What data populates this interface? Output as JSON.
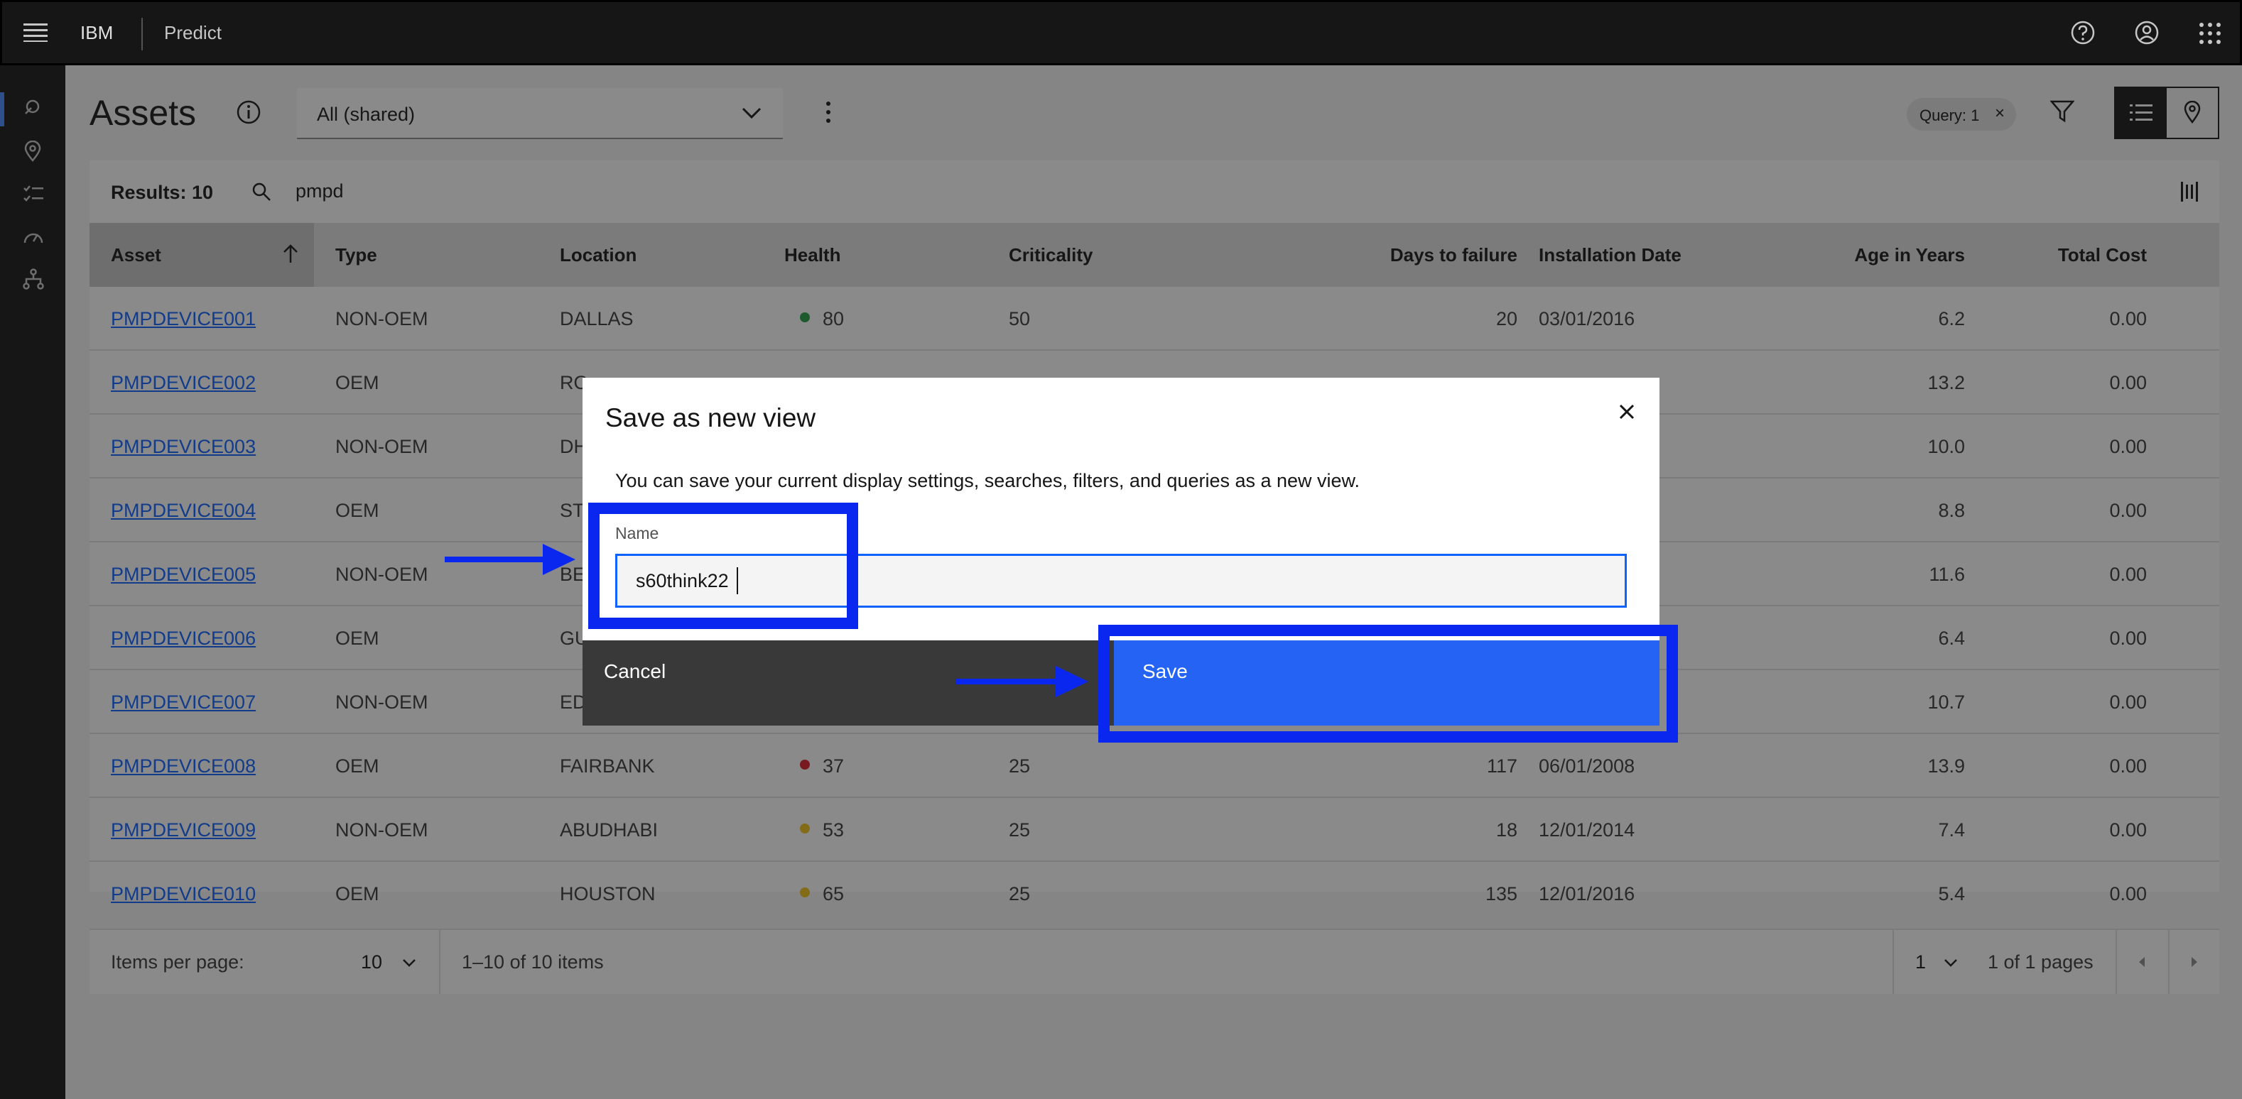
{
  "header": {
    "brand": "IBM",
    "product": "Predict"
  },
  "page": {
    "title": "Assets",
    "view_selector": {
      "value": "All (shared)"
    },
    "query_tag": "Query: 1",
    "results_label": "Results: 10",
    "search_value": "pmpd"
  },
  "table": {
    "columns": [
      "Asset",
      "Type",
      "Location",
      "Health",
      "Criticality",
      "Days to failure",
      "Installation Date",
      "Age in Years",
      "Total Cost"
    ],
    "rows": [
      {
        "asset": "PMPDEVICE001",
        "type": "NON-OEM",
        "location": "DALLAS",
        "health": "80",
        "health_color": "#24a148",
        "criticality": "50",
        "days": "20",
        "install": "03/01/2016",
        "age": "6.2",
        "cost": "0.00"
      },
      {
        "asset": "PMPDEVICE002",
        "type": "OEM",
        "location": "RO",
        "health": "",
        "health_color": "",
        "criticality": "",
        "days": "",
        "install": "",
        "age": "13.2",
        "cost": "0.00"
      },
      {
        "asset": "PMPDEVICE003",
        "type": "NON-OEM",
        "location": "DH",
        "health": "",
        "health_color": "",
        "criticality": "",
        "days": "",
        "install": "",
        "age": "10.0",
        "cost": "0.00"
      },
      {
        "asset": "PMPDEVICE004",
        "type": "OEM",
        "location": "ST",
        "health": "",
        "health_color": "",
        "criticality": "",
        "days": "",
        "install": "",
        "age": "8.8",
        "cost": "0.00"
      },
      {
        "asset": "PMPDEVICE005",
        "type": "NON-OEM",
        "location": "BE",
        "health": "",
        "health_color": "",
        "criticality": "",
        "days": "",
        "install": "",
        "age": "11.6",
        "cost": "0.00"
      },
      {
        "asset": "PMPDEVICE006",
        "type": "OEM",
        "location": "GU",
        "health": "",
        "health_color": "",
        "criticality": "",
        "days": "",
        "install": "",
        "age": "6.4",
        "cost": "0.00"
      },
      {
        "asset": "PMPDEVICE007",
        "type": "NON-OEM",
        "location": "ED",
        "health": "",
        "health_color": "",
        "criticality": "",
        "days": "",
        "install": "",
        "age": "10.7",
        "cost": "0.00"
      },
      {
        "asset": "PMPDEVICE008",
        "type": "OEM",
        "location": "FAIRBANK",
        "health": "37",
        "health_color": "#da1e28",
        "criticality": "25",
        "days": "117",
        "install": "06/01/2008",
        "age": "13.9",
        "cost": "0.00"
      },
      {
        "asset": "PMPDEVICE009",
        "type": "NON-OEM",
        "location": "ABUDHABI",
        "health": "53",
        "health_color": "#f1c21b",
        "criticality": "25",
        "days": "18",
        "install": "12/01/2014",
        "age": "7.4",
        "cost": "0.00"
      },
      {
        "asset": "PMPDEVICE010",
        "type": "OEM",
        "location": "HOUSTON",
        "health": "65",
        "health_color": "#f1c21b",
        "criticality": "25",
        "days": "135",
        "install": "12/01/2016",
        "age": "5.4",
        "cost": "0.00"
      }
    ]
  },
  "pagination": {
    "items_per_page_label": "Items per page:",
    "items_per_page_value": "10",
    "range_text": "1–10 of 10 items",
    "page_value": "1",
    "page_total_text": "1 of 1 pages"
  },
  "modal": {
    "title": "Save as new view",
    "description": "You can save your current display settings, searches, filters, and queries as a new view.",
    "name_label": "Name",
    "name_value": "s60think22",
    "cancel_label": "Cancel",
    "save_label": "Save"
  },
  "colors": {
    "annotation": "#0a27f0",
    "primary": "#2563f5",
    "header": "#161616"
  }
}
